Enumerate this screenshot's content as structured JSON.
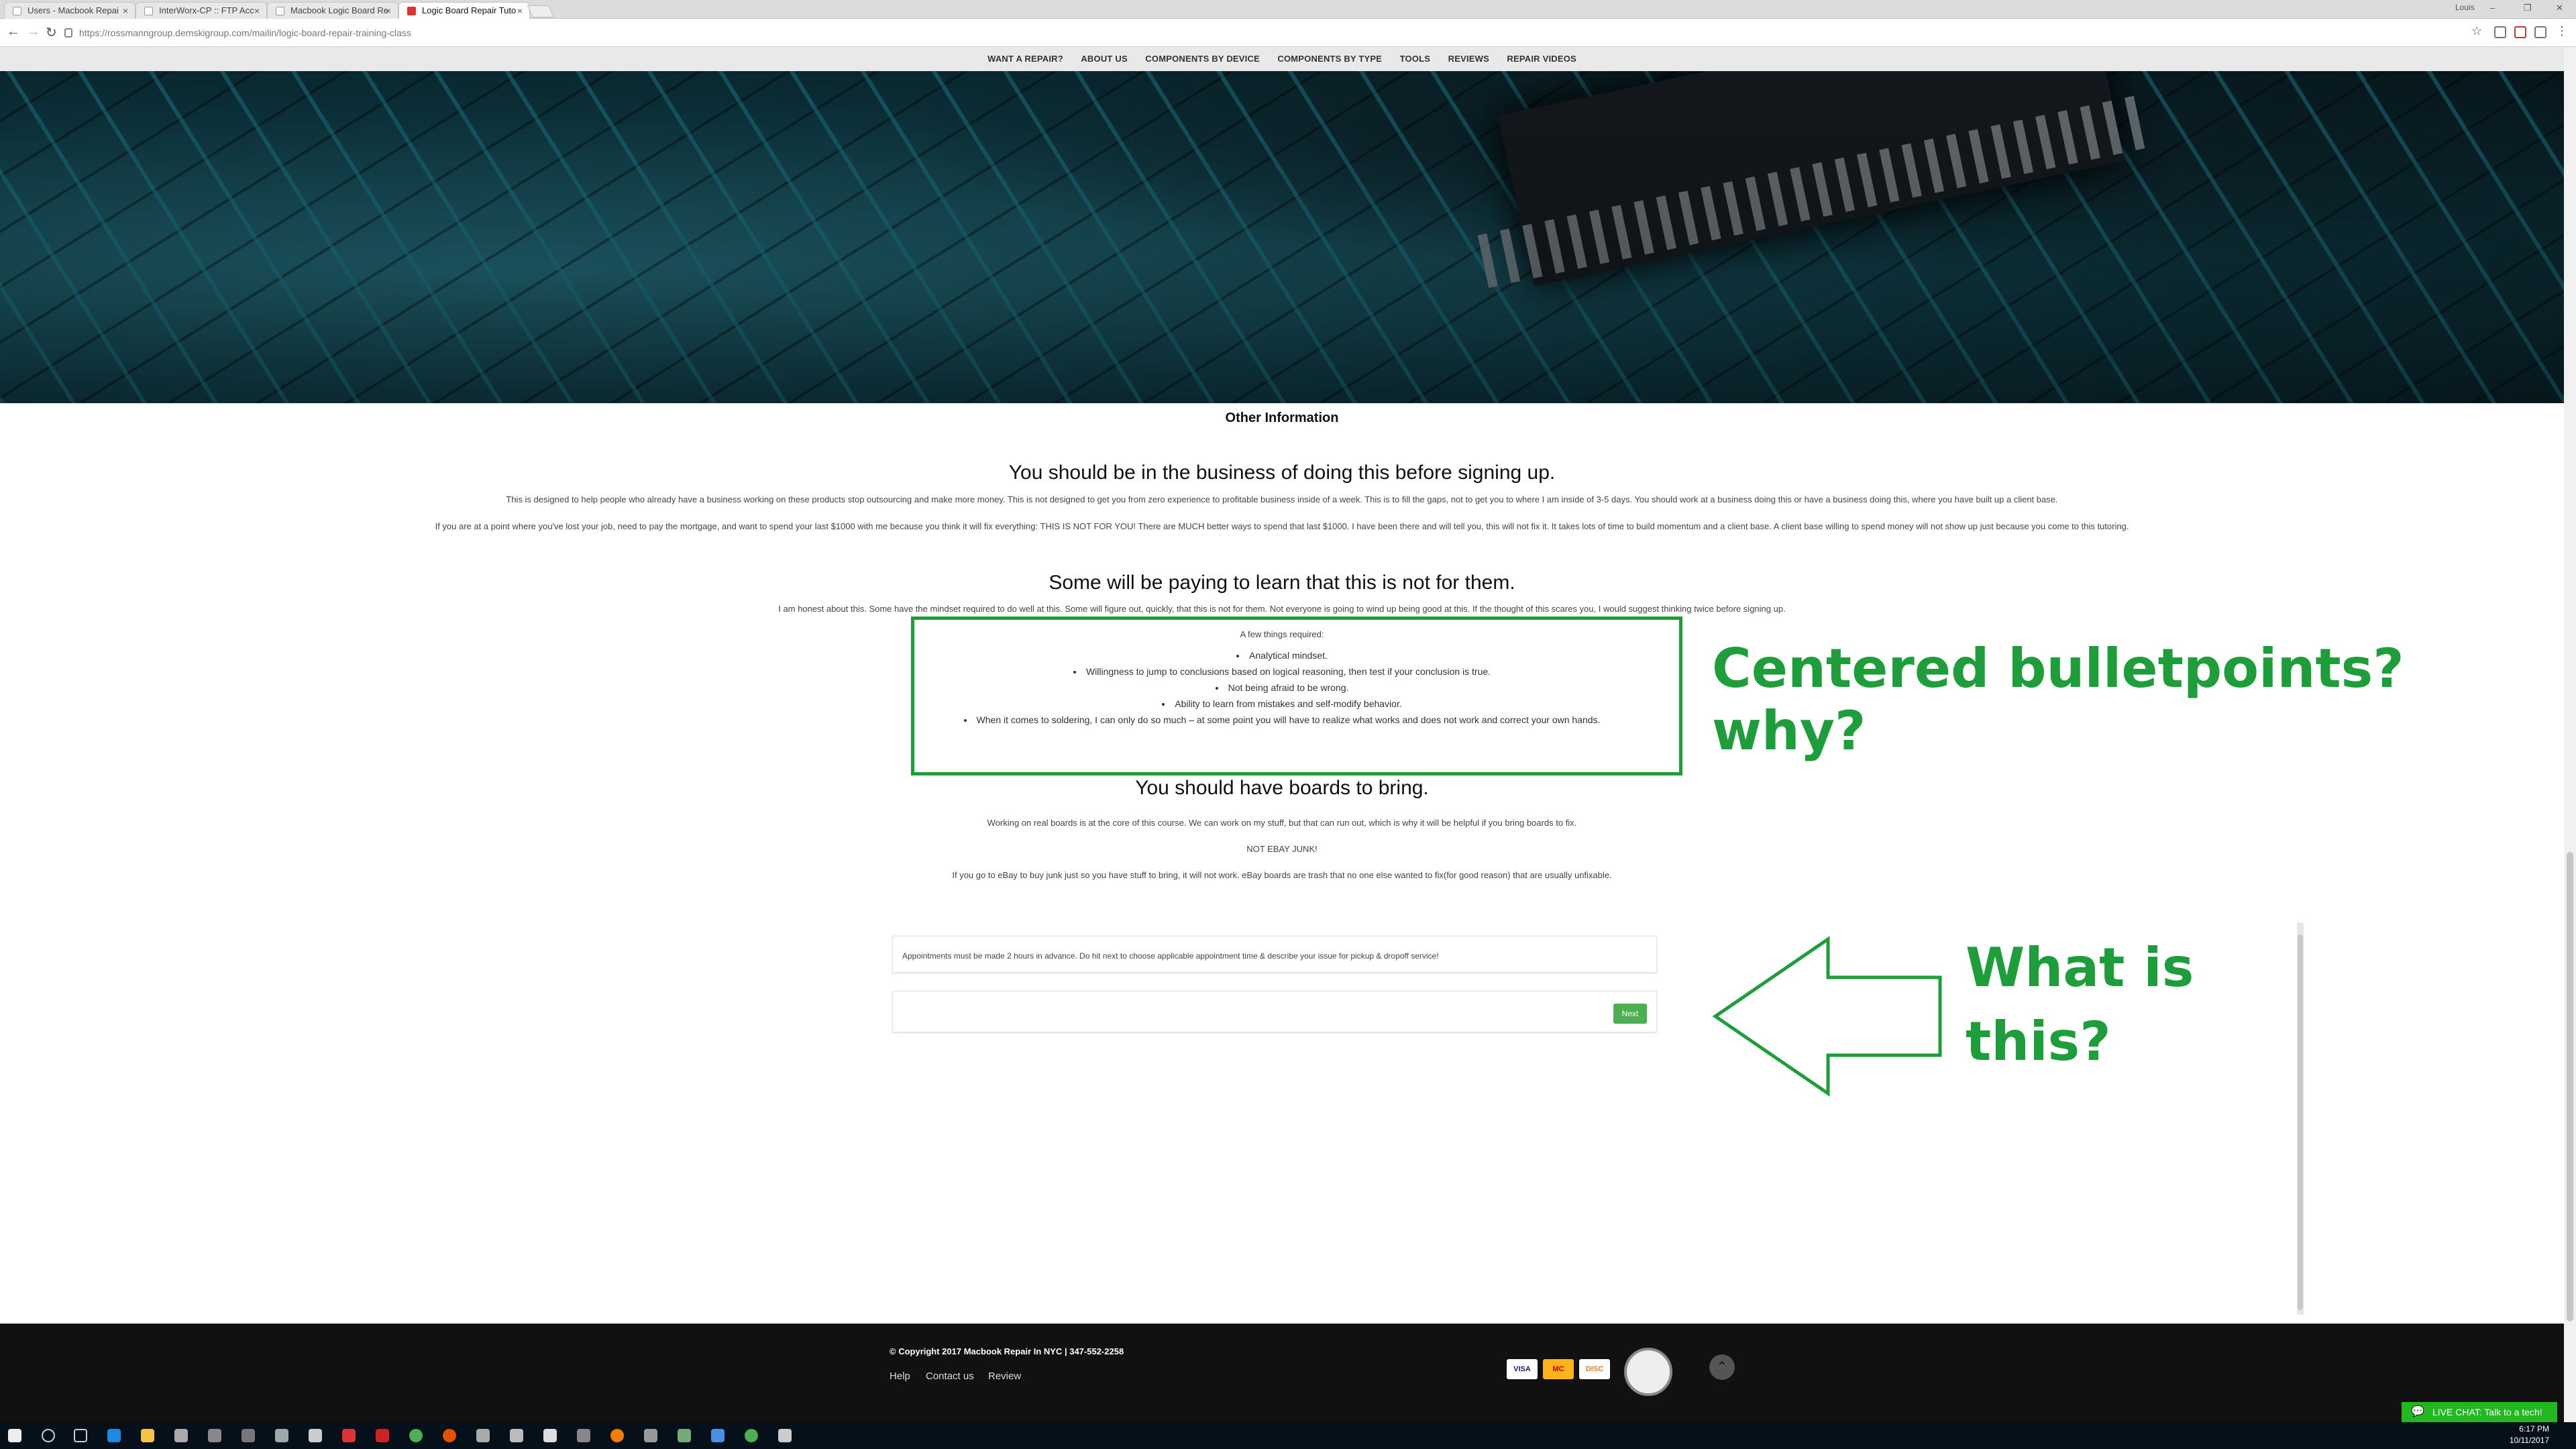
{
  "browser": {
    "tabs": [
      {
        "label": "Users - Macbook Repai"
      },
      {
        "label": "InterWorx-CP :: FTP Acc"
      },
      {
        "label": "Macbook Logic Board Re"
      },
      {
        "label": "Logic Board Repair Tuto"
      }
    ],
    "user": "Louis",
    "url": "https://rossmanngroup.demskigroup.com/mailin/logic-board-repair-training-class"
  },
  "site_nav": {
    "items": [
      "WANT A REPAIR?",
      "ABOUT US",
      "COMPONENTS BY DEVICE",
      "COMPONENTS BY TYPE",
      "TOOLS",
      "REVIEWS",
      "REPAIR VIDEOS"
    ]
  },
  "content": {
    "other_info": "Other Information",
    "h1": "You should be in the business of doing this before signing up.",
    "p1": "This is designed to help people who already have a business working on these products stop outsourcing and make more money. This is not designed to get you from zero experience to profitable business inside of a week. This is to fill the gaps, not to get you to where I am inside of 3-5 days. You should work at a business doing this or have a business doing this, where you have built up a client base.",
    "p2": "If you are at a point where you've lost your job, need to pay the mortgage, and want to spend your last $1000 with me because you think it will fix everything: THIS IS NOT FOR YOU! There are MUCH better ways to spend that last $1000. I have been there and will tell you, this will not fix it. It takes lots of time to build momentum and a client base. A client base willing to spend money will not show up just because you come to this tutoring.",
    "h2": "Some will be paying to learn that this is not for them.",
    "p3": "I am honest about this. Some have the mindset required to do well at this. Some will figure out, quickly, that this is not for them. Not everyone is going to wind up being good at this. If the thought of this scares you, I would suggest thinking twice before signing up.",
    "req_intro": "A few things required:",
    "requirements": [
      "Analytical mindset.",
      "Willingness to jump to conclusions based on logical reasoning, then test if your conclusion is true.",
      "Not being afraid to be wrong.",
      "Ability to learn from mistakes and self-modify behavior.",
      "When it comes to soldering, I can only do so much – at some point you will have to realize what works and does not work and correct your own hands."
    ],
    "h3": "You should have boards to bring.",
    "p4": "Working on real boards is at the core of this course. We can work on my stuff, but that can run out, which is why it will be helpful if you bring boards to fix.",
    "p5": "NOT EBAY JUNK!",
    "p6": "If you go to eBay to buy junk just so you have stuff to bring, it will not work. eBay boards are trash that no one else wanted to fix(for good reason) that are usually unfixable."
  },
  "booking": {
    "notice": "Appointments must be made 2 hours in advance. Do hit next to choose applicable appointment time & describe your issue for pickup & dropoff service!",
    "next_label": "Next"
  },
  "annotations": {
    "bullets": "Centered bulletpoints? why?",
    "what_line1": "What is",
    "what_line2": "this?",
    "color": "#1e9e3a"
  },
  "footer": {
    "copyright": "© Copyright 2017 Macbook Repair In NYC | 347-552-2258",
    "links": [
      "Help",
      "Contact us",
      "Review"
    ],
    "cards": [
      "VISA",
      "MC",
      "DISC"
    ]
  },
  "live_chat": "LIVE CHAT: Talk to a tech!",
  "taskbar": {
    "time": "6:17 PM",
    "date": "10/11/2017"
  }
}
